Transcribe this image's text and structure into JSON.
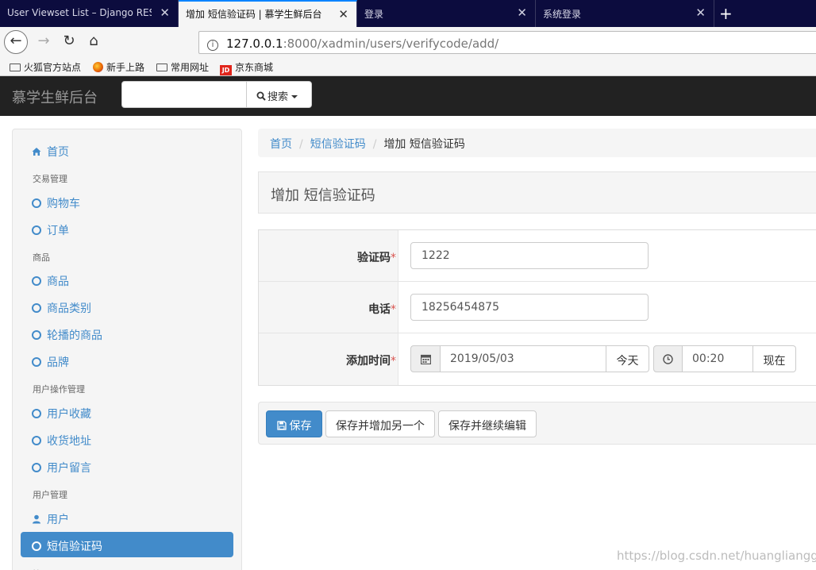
{
  "browser": {
    "tabs": [
      {
        "title": "User Viewset List – Django REST",
        "active": false
      },
      {
        "title": "增加 短信验证码 | 慕学生鲜后台",
        "active": true
      },
      {
        "title": "登录",
        "active": false
      },
      {
        "title": "系统登录",
        "active": false
      }
    ],
    "tab_close": "✕",
    "new_tab": "+",
    "url": {
      "host": "127.0.0.1",
      "rest": ":8000/xadmin/users/verifycode/add/"
    },
    "bookmarks": [
      "火狐官方站点",
      "新手上路",
      "常用网址",
      "京东商城"
    ],
    "jd_badge": "JD"
  },
  "header": {
    "brand": "慕学生鲜后台",
    "search_button": "搜索"
  },
  "sidebar": {
    "home": "首页",
    "groups": [
      {
        "header": "交易管理",
        "items": [
          "购物车",
          "订单"
        ]
      },
      {
        "header": "商品",
        "items": [
          "商品",
          "商品类别",
          "轮播的商品",
          "品牌"
        ]
      },
      {
        "header": "用户操作管理",
        "items": [
          "用户收藏",
          "收货地址",
          "用户留言"
        ]
      },
      {
        "header": "用户管理",
        "items": [
          "用户",
          "短信验证码"
        ]
      },
      {
        "header": "管理",
        "items": []
      }
    ]
  },
  "breadcrumb": {
    "home": "首页",
    "section": "短信验证码",
    "current": "增加 短信验证码",
    "sep": "/"
  },
  "page_title": "增加 短信验证码",
  "form": {
    "code_label": "验证码",
    "code_value": "1222",
    "phone_label": "电话",
    "phone_value": "18256454875",
    "time_label": "添加时间",
    "date_value": "2019/05/03",
    "today_button": "今天",
    "time_value": "00:20",
    "now_button": "现在",
    "required_mark": "*"
  },
  "actions": {
    "save": "保存",
    "save_add_another": "保存并增加另一个",
    "save_continue": "保存并继续编辑"
  },
  "watermark": "https://blog.csdn.net/huangliangggu",
  "colors": {
    "primary": "#428bca",
    "navbar": "#222222",
    "tabbar": "#0c0c3e"
  }
}
